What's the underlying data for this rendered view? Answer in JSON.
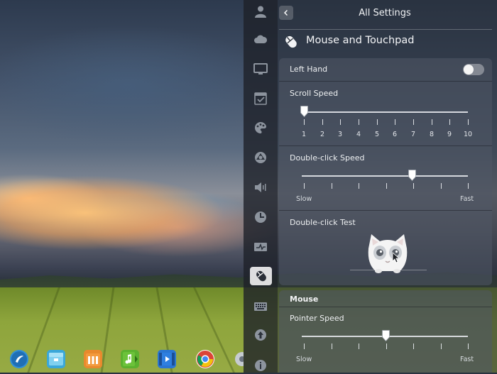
{
  "header": {
    "title": "All Settings"
  },
  "section": {
    "title": "Mouse and Touchpad"
  },
  "left_hand": {
    "label": "Left Hand",
    "enabled": false
  },
  "scroll_speed": {
    "label": "Scroll Speed",
    "ticks": [
      "1",
      "2",
      "3",
      "4",
      "5",
      "6",
      "7",
      "8",
      "9",
      "10"
    ],
    "value": 1
  },
  "double_click_speed": {
    "label": "Double-click Speed",
    "min_label": "Slow",
    "max_label": "Fast",
    "value_fraction": 0.66
  },
  "double_click_test": {
    "label": "Double-click Test"
  },
  "mouse": {
    "heading": "Mouse",
    "pointer_speed": {
      "label": "Pointer Speed",
      "min_label": "Slow",
      "max_label": "Fast",
      "value_fraction": 0.5
    }
  },
  "sidebar": {
    "items": [
      {
        "icon": "account-icon"
      },
      {
        "icon": "cloud-sync-icon"
      },
      {
        "icon": "display-icon"
      },
      {
        "icon": "default-apps-icon"
      },
      {
        "icon": "personalization-icon"
      },
      {
        "icon": "network-icon"
      },
      {
        "icon": "sound-icon"
      },
      {
        "icon": "time-icon"
      },
      {
        "icon": "power-icon"
      },
      {
        "icon": "mouse-icon",
        "active": true
      },
      {
        "icon": "keyboard-icon"
      },
      {
        "icon": "update-icon"
      },
      {
        "icon": "info-icon"
      }
    ]
  },
  "dock": {
    "items": [
      {
        "icon": "launcher-icon",
        "color": "#2f8fd8"
      },
      {
        "icon": "file-manager-icon",
        "color": "#3aa7d9"
      },
      {
        "icon": "app-store-icon",
        "color": "#e8892d"
      },
      {
        "icon": "music-icon",
        "color": "#5bb12f"
      },
      {
        "icon": "video-icon",
        "color": "#2a76d2"
      },
      {
        "icon": "chrome-icon",
        "color": "#db4437"
      },
      {
        "icon": "settings-icon",
        "color": "#9aa0a8"
      }
    ]
  },
  "colors": {
    "accent": "#ffffff",
    "card": "#505866"
  }
}
